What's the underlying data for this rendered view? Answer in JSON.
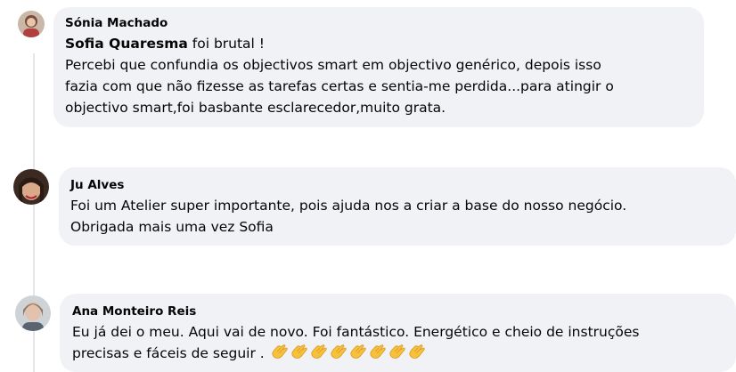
{
  "comments": [
    {
      "author": "Sónia Machado",
      "mention": "Sofia Quaresma",
      "lines": [
        "foi brutal !",
        "Percebi que confundia os objectivos smart em objectivo genérico, depois isso",
        "fazia com que não fizesse as tarefas certas e sentia-me perdida...para atingir o",
        "objectivo smart,foi basbante esclarecedor,muito grata."
      ]
    },
    {
      "author": "Ju Alves",
      "lines": [
        "Foi um Atelier super importante, pois ajuda nos a criar a base do nosso negócio.",
        "Obrigada mais uma vez Sofia"
      ]
    },
    {
      "author": "Ana Monteiro Reis",
      "lines": [
        "Eu já dei o meu. Aqui vai de novo. Foi fantástico. Energético e cheio de instruções",
        "precisas e fáceis de seguir ."
      ],
      "emoji": [
        "clapping-hands",
        "clapping-hands",
        "clapping-hands",
        "clapping-hands",
        "clapping-hands",
        "clapping-hands",
        "clapping-hands",
        "clapping-hands"
      ]
    }
  ],
  "colors": {
    "bubble": "#f0f2f5",
    "text": "#050505",
    "thread_line": "#e4e6eb"
  }
}
